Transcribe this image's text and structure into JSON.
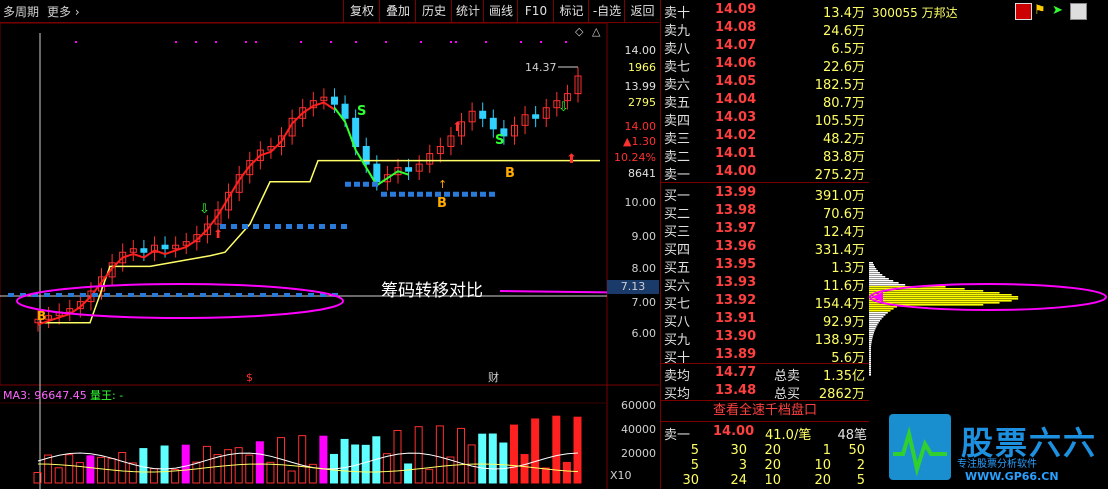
{
  "toolbar": {
    "period": "多周期",
    "more": "更多",
    "buttons": [
      "复权",
      "叠加",
      "历史",
      "统计",
      "画线",
      "F10",
      "标记",
      "-自选",
      "返回"
    ]
  },
  "chart": {
    "high_label": "14.37",
    "annotation": "筹码转移对比",
    "marker_cross": "7.13",
    "right_axis": {
      "info": [
        "14.00",
        "1966",
        "13.99",
        "2795",
        "14.00",
        "▲1.30",
        "10.24%",
        "8641"
      ],
      "ticks": [
        "10.00",
        "9.00",
        "8.00",
        "7.00",
        "6.00"
      ]
    },
    "bottom_markers": [
      "$",
      "财"
    ],
    "volume": {
      "ma_label": "MA3: 96647.45",
      "indicator": "量王: -",
      "ticks": [
        "60000",
        "40000",
        "20000"
      ],
      "unit": "X10"
    },
    "signals": {
      "s": "S",
      "b": "B"
    }
  },
  "orderbook": {
    "sell": [
      {
        "name": "卖十",
        "price": "14.09",
        "vol": "13.4",
        "unit": "万"
      },
      {
        "name": "卖九",
        "price": "14.08",
        "vol": "24.6",
        "unit": "万"
      },
      {
        "name": "卖八",
        "price": "14.07",
        "vol": "6.5",
        "unit": "万"
      },
      {
        "name": "卖七",
        "price": "14.06",
        "vol": "22.6",
        "unit": "万"
      },
      {
        "name": "卖六",
        "price": "14.05",
        "vol": "182.5",
        "unit": "万"
      },
      {
        "name": "卖五",
        "price": "14.04",
        "vol": "80.7",
        "unit": "万"
      },
      {
        "name": "卖四",
        "price": "14.03",
        "vol": "105.5",
        "unit": "万"
      },
      {
        "name": "卖三",
        "price": "14.02",
        "vol": "48.2",
        "unit": "万"
      },
      {
        "name": "卖二",
        "price": "14.01",
        "vol": "83.8",
        "unit": "万"
      },
      {
        "name": "卖一",
        "price": "14.00",
        "vol": "275.2",
        "unit": "万"
      }
    ],
    "buy": [
      {
        "name": "买一",
        "price": "13.99",
        "vol": "391.0",
        "unit": "万"
      },
      {
        "name": "买二",
        "price": "13.98",
        "vol": "70.6",
        "unit": "万"
      },
      {
        "name": "买三",
        "price": "13.97",
        "vol": "12.4",
        "unit": "万"
      },
      {
        "name": "买四",
        "price": "13.96",
        "vol": "331.4",
        "unit": "万"
      },
      {
        "name": "买五",
        "price": "13.95",
        "vol": "1.3",
        "unit": "万"
      },
      {
        "name": "买六",
        "price": "13.93",
        "vol": "11.6",
        "unit": "万"
      },
      {
        "name": "买七",
        "price": "13.92",
        "vol": "154.4",
        "unit": "万"
      },
      {
        "name": "买八",
        "price": "13.91",
        "vol": "92.9",
        "unit": "万"
      },
      {
        "name": "买九",
        "price": "13.90",
        "vol": "138.9",
        "unit": "万"
      },
      {
        "name": "买十",
        "price": "13.89",
        "vol": "5.6",
        "unit": "万"
      }
    ],
    "summary": {
      "sell_avg_label": "卖均",
      "sell_avg": "14.77",
      "sell_total_label": "总卖",
      "sell_total": "1.35亿",
      "buy_avg_label": "买均",
      "buy_avg": "13.48",
      "buy_total_label": "总买",
      "buy_total": "2862万"
    },
    "view_all": "查看全速千档盘口",
    "first_sell": {
      "name": "卖一",
      "price": "14.00",
      "vol": "41.0/笔",
      "count": "48笔"
    },
    "queue": [
      [
        "5",
        "30",
        "20",
        "1",
        "50"
      ],
      [
        "5",
        "3",
        "20",
        "10",
        "2"
      ],
      [
        "30",
        "24",
        "10",
        "20",
        "5"
      ]
    ]
  },
  "stock": {
    "code_name": "300055 万邦达"
  },
  "watermark": {
    "brand": "股票六六",
    "slogan": "专注股票分析软件",
    "url": "WWW.GP66.CN"
  },
  "colors": {
    "up": "#ff3030",
    "down": "#2a7bd9",
    "accent": "#ff00ff",
    "ma": "#ffff66"
  }
}
